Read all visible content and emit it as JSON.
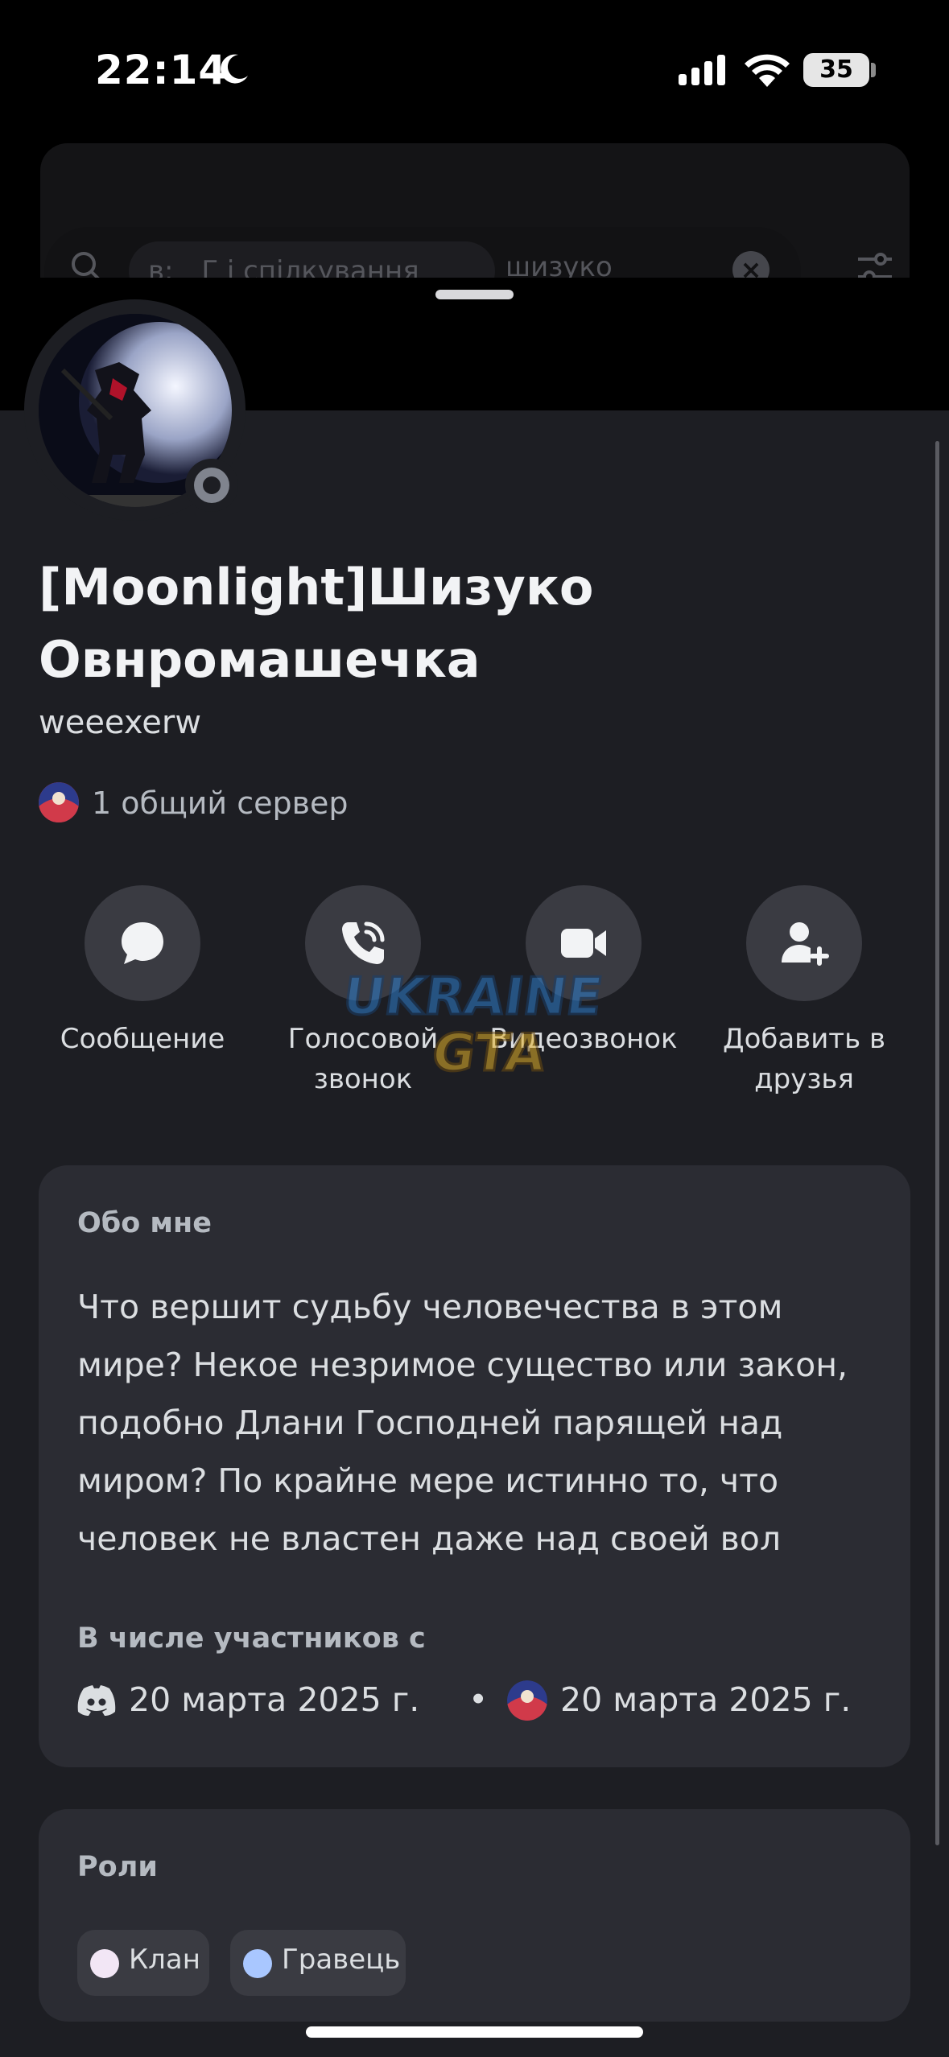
{
  "status_bar": {
    "time": "22:14",
    "battery": "35"
  },
  "background": {
    "search_prefix": "в:",
    "search_chip": "Г     і  спілкування",
    "search_query": "шизуко"
  },
  "profile": {
    "display_name": "[Moonlight]Шизуко Овнромашечка",
    "username": "weeexerw",
    "mutual_servers": "1 общий сервер",
    "presence": "offline"
  },
  "actions": [
    {
      "label": "Сообщение",
      "icon": "message-bubble-icon"
    },
    {
      "label": "Голосовой звонок",
      "icon": "phone-call-icon"
    },
    {
      "label": "Видеозвонок",
      "icon": "video-camera-icon"
    },
    {
      "label": "Добавить в друзья",
      "icon": "add-friend-icon"
    }
  ],
  "watermark": "UKRAINE GTA",
  "about": {
    "title": "Обо мне",
    "text": "Что вершит судьбу человечества в этом мире? Некое незримое существо или закон, подобно Длани Господней парящей над миром? По крайне мере истинно то, что человек не властен даже над своей вол",
    "member_since_title": "В числе участников с",
    "discord_date": "20 марта 2025 г.",
    "separator": "•",
    "server_date": "20 марта 2025 г."
  },
  "roles": {
    "title": "Роли",
    "items": [
      {
        "label": "Клан",
        "color": "#f2e6f5"
      },
      {
        "label": "Гравець",
        "color": "#a9c7ff"
      }
    ]
  },
  "colors": {
    "sheet_bg": "#1d1e23",
    "card_bg": "#2b2c33",
    "button_bg": "#3a3b42",
    "offline": "#80848e"
  }
}
